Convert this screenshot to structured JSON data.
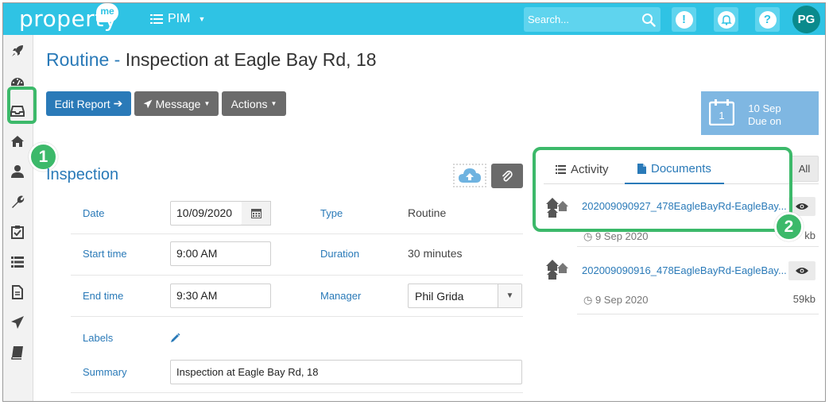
{
  "app": {
    "logo_text": "property",
    "logo_badge": "me",
    "module_label": "PIM",
    "search_placeholder": "Search...",
    "avatar_initials": "PG"
  },
  "page": {
    "title_prefix": "Routine -",
    "title_main": "Inspection at Eagle Bay Rd, 18"
  },
  "toolbar": {
    "edit_report": "Edit Report",
    "message": "Message",
    "actions": "Actions"
  },
  "due": {
    "date": "10 Sep",
    "label": "Due on",
    "calendar_day": "1"
  },
  "section": {
    "title": "Inspection"
  },
  "form": {
    "date_label": "Date",
    "date_value": "10/09/2020",
    "type_label": "Type",
    "type_value": "Routine",
    "start_label": "Start time",
    "start_value": "9:00 AM",
    "duration_label": "Duration",
    "duration_value": "30 minutes",
    "end_label": "End time",
    "end_value": "9:30 AM",
    "manager_label": "Manager",
    "manager_value": "Phil Grida",
    "labels_label": "Labels",
    "summary_label": "Summary",
    "summary_value": "Inspection at Eagle Bay Rd, 18"
  },
  "panel": {
    "tab_activity": "Activity",
    "tab_documents": "Documents",
    "all_button": "All",
    "documents": [
      {
        "name": "202009090927_478EagleBayRd-EagleBay...",
        "date": "9 Sep 2020",
        "size": "kb"
      },
      {
        "name": "202009090916_478EagleBayRd-EagleBay...",
        "date": "9 Sep 2020",
        "size": "59kb"
      }
    ]
  },
  "callouts": {
    "one": "1",
    "two": "2"
  },
  "colors": {
    "topbar": "#2fc3e4",
    "primary": "#2a7ab8",
    "callout": "#3cb96a",
    "grey_button": "#6b6b6b"
  }
}
